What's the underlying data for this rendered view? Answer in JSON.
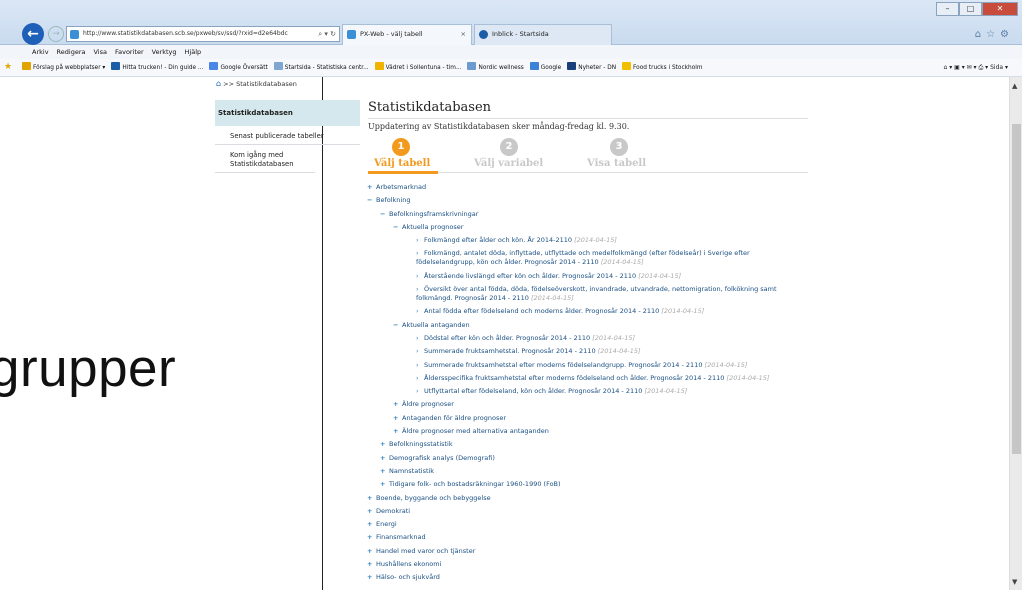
{
  "browser": {
    "address": "http://www.statistikdatabasen.scb.se/pxweb/sv/ssd/?rxid=d2e64bdc",
    "address_controls": "⌕ ▾ ↻",
    "tabs": [
      {
        "label": "PX-Web - välj tabell",
        "active": true
      },
      {
        "label": "Inblick - Startsida",
        "active": false
      }
    ],
    "menu": [
      "Arkiv",
      "Redigera",
      "Visa",
      "Favoriter",
      "Verktyg",
      "Hjälp"
    ],
    "favorites": [
      {
        "label": "Förslag på webbplatser ▾",
        "color": "#e2a400"
      },
      {
        "label": "Hitta trucken! - Din guide ...",
        "color": "#1c5da8"
      },
      {
        "label": "Google Översätt",
        "color": "#4a86e8"
      },
      {
        "label": "Startsida - Statistiska centr...",
        "color": "#7fa7cf"
      },
      {
        "label": "Vädret i Sollentuna - tim...",
        "color": "#f0b400"
      },
      {
        "label": "Nordic wellness",
        "color": "#6b9bd0"
      },
      {
        "label": "Google",
        "color": "#3b82d8"
      },
      {
        "label": "Nyheter - DN",
        "color": "#1a3f7a"
      },
      {
        "label": "Food trucks i Stockholm",
        "color": "#f0c000"
      }
    ],
    "toolbar_right": "Sida ▾"
  },
  "overlay_word": "grupper",
  "breadcrumb": ">> Statistikdatabasen",
  "sidenav": {
    "head": "Statistikdatabasen",
    "items": [
      "Senast publicerade tabeller",
      "Kom igång med Statistikdatabasen"
    ]
  },
  "main": {
    "title": "Statistikdatabasen",
    "subtitle": "Uppdatering av Statistikdatabasen sker måndag-fredag kl. 9.30.",
    "steps": [
      {
        "num": "1",
        "label": "Välj tabell",
        "active": true
      },
      {
        "num": "2",
        "label": "Välj variabel",
        "active": false
      },
      {
        "num": "3",
        "label": "Visa tabell",
        "active": false
      }
    ]
  },
  "tree": [
    {
      "level": 0,
      "type": "plus",
      "text": "Arbetsmarknad"
    },
    {
      "level": 0,
      "type": "minus",
      "text": "Befolkning"
    },
    {
      "level": 1,
      "type": "minus",
      "text": "Befolkningsframskrivningar"
    },
    {
      "level": 2,
      "type": "minus",
      "text": "Aktuella prognoser"
    },
    {
      "level": 3,
      "type": "leaf",
      "text": "Folkmängd efter ålder och kön. År 2014-2110",
      "date": "[2014-04-15]"
    },
    {
      "level": 3,
      "type": "leaf",
      "text": "Folkmängd, antalet döda, inflyttade, utflyttade och medelfolkmängd (efter födelseår) i Sverige efter födelselandgrupp, kön och ålder. Prognosår 2014 - 2110",
      "date": "[2014-04-15]"
    },
    {
      "level": 3,
      "type": "leaf",
      "text": "Återstående livslängd efter kön och ålder. Prognosår 2014 - 2110",
      "date": "[2014-04-15]"
    },
    {
      "level": 3,
      "type": "leaf",
      "text": "Översikt över antal födda, döda, födelseöverskott, invandrade, utvandrade, nettomigration, folkökning samt folkmängd. Prognosår 2014 - 2110",
      "date": "[2014-04-15]"
    },
    {
      "level": 3,
      "type": "leaf",
      "text": "Antal födda efter födelseland och moderns ålder. Prognosår 2014 - 2110",
      "date": "[2014-04-15]"
    },
    {
      "level": 2,
      "type": "minus",
      "text": "Aktuella antaganden"
    },
    {
      "level": 3,
      "type": "leaf",
      "text": "Dödstal efter kön och ålder. Prognosår 2014 - 2110",
      "date": "[2014-04-15]"
    },
    {
      "level": 3,
      "type": "leaf",
      "text": "Summerade fruktsamhetstal. Prognosår 2014 - 2110",
      "date": "[2014-04-15]"
    },
    {
      "level": 3,
      "type": "leaf",
      "text": "Summerade fruktsamhetstal efter moderns födelselandgrupp. Prognosår 2014 - 2110",
      "date": "[2014-04-15]"
    },
    {
      "level": 3,
      "type": "leaf",
      "text": "Åldersspecifika fruktsamhetstal efter moderns födelseland och ålder. Prognosår 2014 - 2110",
      "date": "[2014-04-15]"
    },
    {
      "level": 3,
      "type": "leaf",
      "text": "Utflyttartal efter födelseland, kön och ålder. Prognosår 2014 - 2110",
      "date": "[2014-04-15]"
    },
    {
      "level": 2,
      "type": "plus",
      "text": "Äldre prognoser"
    },
    {
      "level": 2,
      "type": "plus",
      "text": "Antaganden för äldre prognoser"
    },
    {
      "level": 2,
      "type": "plus",
      "text": "Äldre prognoser med alternativa antaganden"
    },
    {
      "level": 1,
      "type": "plus",
      "text": "Befolkningsstatistik"
    },
    {
      "level": 1,
      "type": "plus",
      "text": "Demografisk analys (Demografi)"
    },
    {
      "level": 1,
      "type": "plus",
      "text": "Namnstatistik"
    },
    {
      "level": 1,
      "type": "plus",
      "text": "Tidigare folk- och bostadsräkningar 1960-1990 (FoB)"
    },
    {
      "level": 0,
      "type": "plus",
      "text": "Boende, byggande och bebyggelse"
    },
    {
      "level": 0,
      "type": "plus",
      "text": "Demokrati"
    },
    {
      "level": 0,
      "type": "plus",
      "text": "Energi"
    },
    {
      "level": 0,
      "type": "plus",
      "text": "Finansmarknad"
    },
    {
      "level": 0,
      "type": "plus",
      "text": "Handel med varor och tjänster"
    },
    {
      "level": 0,
      "type": "plus",
      "text": "Hushållens ekonomi"
    },
    {
      "level": 0,
      "type": "plus",
      "text": "Hälso- och sjukvård"
    }
  ],
  "colors": {
    "accent": "#f39a1e",
    "link": "#1a4f82",
    "step_inactive": "#c8c8c8"
  }
}
